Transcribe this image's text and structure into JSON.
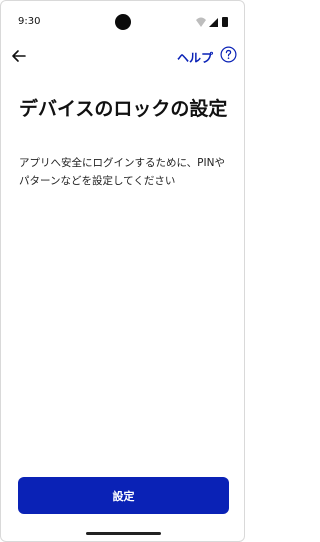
{
  "status_bar": {
    "time": "9:30",
    "icons": [
      "wifi-icon",
      "signal-icon",
      "battery-icon"
    ]
  },
  "header": {
    "back_icon": "arrow-left-icon",
    "help_label": "ヘルプ",
    "help_icon": "question-circle-icon"
  },
  "main": {
    "title": "デバイスのロックの設定",
    "description": "アプリへ安全にログインするために、PINやパターンなどを設定してください"
  },
  "footer": {
    "primary_button_label": "設定"
  },
  "colors": {
    "accent": "#0a22b6",
    "background": "#ffffff",
    "text": "#111111"
  }
}
